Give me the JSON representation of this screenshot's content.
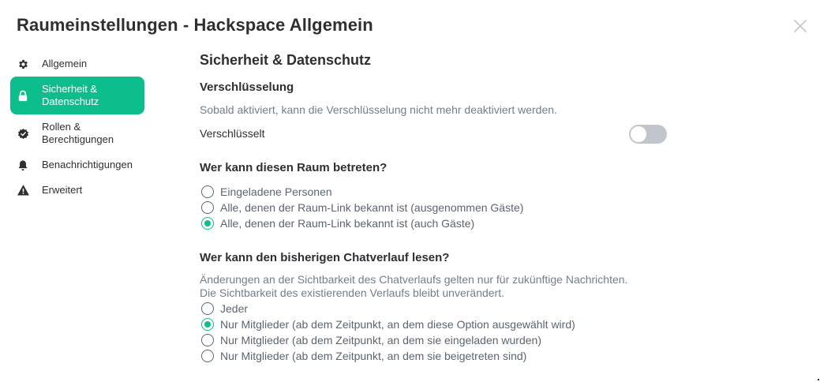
{
  "dialog": {
    "title": "Raumeinstellungen - Hackspace Allgemein",
    "close_icon": "close-icon"
  },
  "sidebar": {
    "items": [
      {
        "label": "Allgemein",
        "icon": "gear-icon",
        "active": false
      },
      {
        "label": "Sicherheit & Datenschutz",
        "icon": "lock-icon",
        "active": true
      },
      {
        "label": "Rollen & Berechtigungen",
        "icon": "shield-check-icon",
        "active": false
      },
      {
        "label": "Benachrichtigungen",
        "icon": "bell-icon",
        "active": false
      },
      {
        "label": "Erweitert",
        "icon": "warning-icon",
        "active": false
      }
    ]
  },
  "main": {
    "title": "Sicherheit & Datenschutz",
    "encryption": {
      "heading": "Verschlüsselung",
      "description": "Sobald aktiviert, kann die Verschlüsselung nicht mehr deaktiviert werden.",
      "toggle_label": "Verschlüsselt",
      "enabled": false
    },
    "join": {
      "heading": "Wer kann diesen Raum betreten?",
      "options": [
        {
          "label": "Eingeladene Personen",
          "checked": false
        },
        {
          "label": "Alle, denen der Raum-Link bekannt ist (ausgenommen Gäste)",
          "checked": false
        },
        {
          "label": "Alle, denen der Raum-Link bekannt ist (auch Gäste)",
          "checked": true
        }
      ]
    },
    "history": {
      "heading": "Wer kann den bisherigen Chatverlauf lesen?",
      "description_line1": "Änderungen an der Sichtbarkeit des Chatverlaufs gelten nur für zukünftige Nachrichten.",
      "description_line2": "Die Sichtbarkeit des existierenden Verlaufs bleibt unverändert.",
      "options": [
        {
          "label": "Jeder",
          "checked": false
        },
        {
          "label": "Nur Mitglieder (ab dem Zeitpunkt, an dem diese Option ausgewählt wird)",
          "checked": true
        },
        {
          "label": "Nur Mitglieder (ab dem Zeitpunkt, an dem sie eingeladen wurden)",
          "checked": false
        },
        {
          "label": "Nur Mitglieder (ab dem Zeitpunkt, an dem sie beigetreten sind)",
          "checked": false
        }
      ]
    }
  },
  "colors": {
    "accent": "#0dbd8b",
    "text_primary": "#2e2f32",
    "text_secondary": "#737d8c",
    "toggle_off": "#c1c6cd"
  }
}
